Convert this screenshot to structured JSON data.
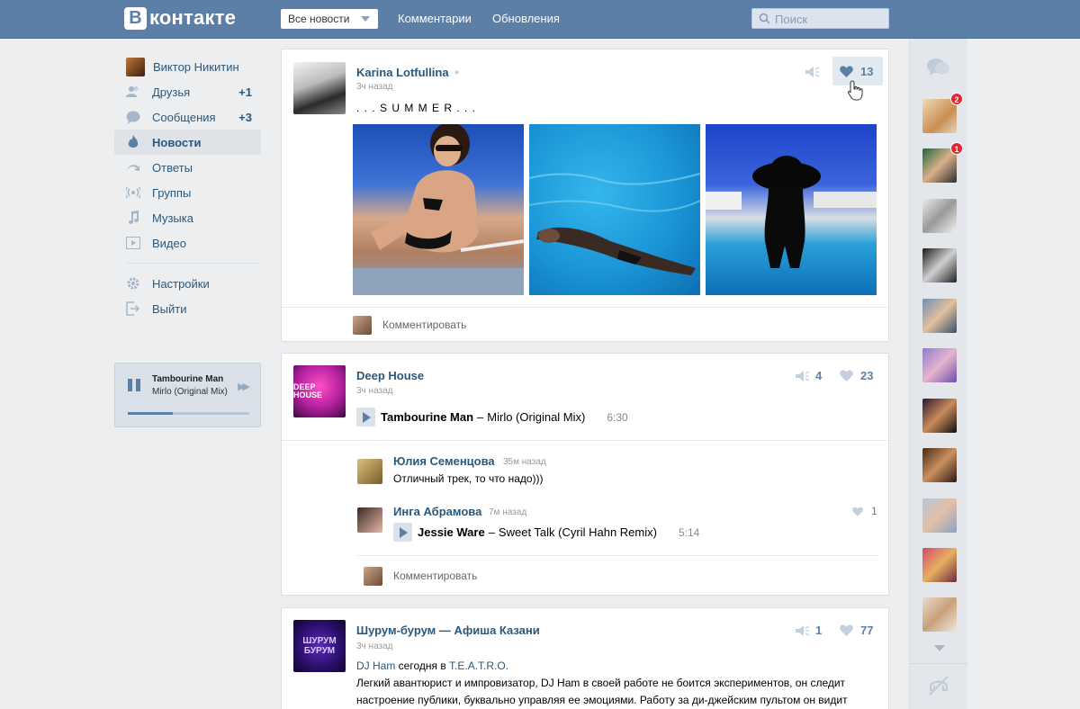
{
  "header": {
    "logo_letter": "В",
    "logo_text": "контакте",
    "filter_value": "Все новости",
    "nav": [
      "Комментарии",
      "Обновления"
    ],
    "search_placeholder": "Поиск"
  },
  "sidebar": {
    "user_name": "Виктор Никитин",
    "items": [
      {
        "label": "Друзья",
        "count": "+1",
        "icon": "friends-icon"
      },
      {
        "label": "Сообщения",
        "count": "+3",
        "icon": "messages-icon"
      },
      {
        "label": "Новости",
        "count": "",
        "icon": "flame-icon",
        "active": true
      },
      {
        "label": "Ответы",
        "count": "",
        "icon": "reply-arrow-icon"
      },
      {
        "label": "Группы",
        "count": "",
        "icon": "broadcast-icon"
      },
      {
        "label": "Музыка",
        "count": "",
        "icon": "music-note-icon"
      },
      {
        "label": "Видео",
        "count": "",
        "icon": "video-icon"
      }
    ],
    "settings_label": "Настройки",
    "logout_label": "Выйти"
  },
  "player": {
    "title": "Tambourine Man",
    "subtitle": "Mirlo (Original Mix)",
    "progress": 0.37
  },
  "posts": [
    {
      "author": "Karina Lotfullina",
      "time": "3ч назад",
      "text": ". . . S U M M E R . . .",
      "likes": "13",
      "comment_label": "Комментировать"
    },
    {
      "author": "Deep House",
      "avatar_text": "DEEP HOUSE",
      "time": "3ч назад",
      "reposts": "4",
      "likes": "23",
      "track": {
        "artist": "Tambourine Man",
        "title": "Mirlo (Original Mix)",
        "duration": "6:30"
      },
      "comments": [
        {
          "author": "Юлия Семенцова",
          "time": "35м назад",
          "text": "Отличный трек, то что надо)))"
        },
        {
          "author": "Инга Абрамова",
          "time": "7м назад",
          "likes": "1",
          "track": {
            "artist": "Jessie Ware",
            "title": "Sweet Talk (Cyril Hahn Remix)",
            "duration": "5:14"
          }
        }
      ],
      "comment_label": "Комментировать"
    },
    {
      "author": "Шурум-бурум — Афиша Казани",
      "avatar_text": "ШУРУМ БУРУМ",
      "time": "3ч назад",
      "reposts": "1",
      "likes": "77",
      "line1_link1": "DJ Ham",
      "line1_mid": " сегодня в ",
      "line1_link2": "T.E.A.T.R.O.",
      "line2": "Легкий авантюрист и импровизатор, DJ Ham в своей работе не боится экспериментов, он следит",
      "line3": "настроение публики, буквально управляя ее эмоциями. Работу за ди-джейским пультом он видит"
    }
  ],
  "chat": {
    "badges": [
      "2",
      "1"
    ],
    "icons": [
      "chat-bubbles-icon",
      "chevron-down-icon",
      "mute-sound-icon"
    ]
  },
  "colors": {
    "header_bg": "#5b7fa6",
    "link": "#2b587a",
    "page_bg": "#edeef0",
    "badge_red": "#e0262f"
  }
}
